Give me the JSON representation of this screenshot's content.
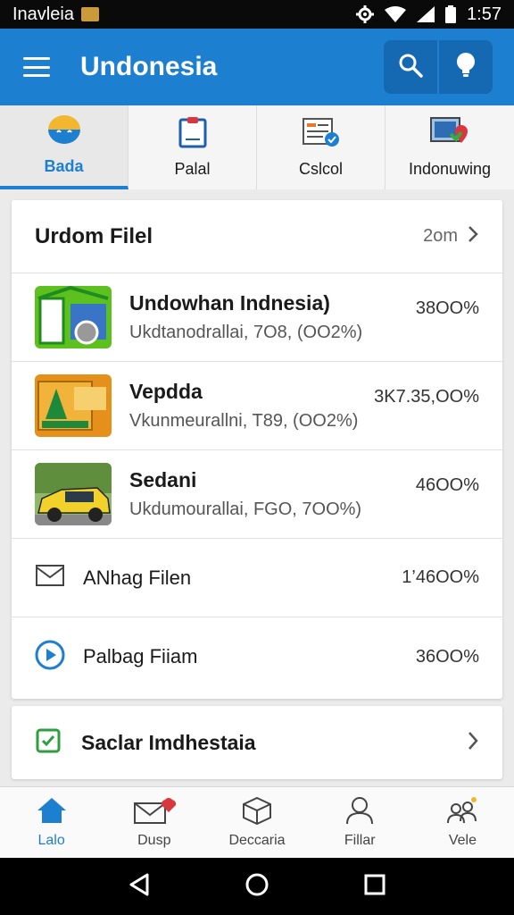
{
  "status_bar": {
    "carrier": "Inavleia",
    "time": "1:57",
    "icons": [
      "gear-icon",
      "wifi-icon",
      "signal-icon",
      "battery-icon"
    ]
  },
  "app_bar": {
    "title": "Undonesia",
    "menu_icon": "menu-icon",
    "actions": [
      "search-icon",
      "lightbulb-icon"
    ],
    "color": "#1d7fd0"
  },
  "tabs": [
    {
      "label": "Bada",
      "icon": "face-icon",
      "active": true
    },
    {
      "label": "Palal",
      "icon": "clipboard-icon",
      "active": false
    },
    {
      "label": "Cslcol",
      "icon": "checklist-icon",
      "active": false
    },
    {
      "label": "Indonuwing",
      "icon": "map-pin-icon",
      "active": false
    }
  ],
  "main_card": {
    "title": "Urdom Filel",
    "header_value": "2om",
    "rows": [
      {
        "title": "Undowhan Indnesia)",
        "subtitle": "Ukdtanodrallai, 7O8, (OO2%)",
        "value": "38OO%"
      },
      {
        "title": "Vepdda",
        "subtitle": "Vkunmeurallni, T89, (OO2%)",
        "value": "3K7.35,OO%"
      },
      {
        "title": "Sedani",
        "subtitle": "Ukdumourallai, FGO, 7OO%)",
        "value": "46OO%"
      },
      {
        "title": "ANhag Filen",
        "icon": "mail-icon",
        "value": "1’46OO%"
      },
      {
        "title": "Palbag Fiiam",
        "icon": "play-circle-icon",
        "value": "36OO%"
      }
    ]
  },
  "bottom_card": {
    "label": "Saclar Imdhestaia",
    "icon": "check-square-icon"
  },
  "bottom_nav": [
    {
      "label": "Lalo",
      "icon": "home-icon",
      "active": true
    },
    {
      "label": "Dusp",
      "icon": "envelope-heart-icon",
      "active": false
    },
    {
      "label": "Deccaria",
      "icon": "box-icon",
      "active": false
    },
    {
      "label": "Fillar",
      "icon": "person-icon",
      "active": false
    },
    {
      "label": "Vele",
      "icon": "people-icon",
      "active": false
    }
  ],
  "system_nav": [
    "back-icon",
    "home-circle-icon",
    "recents-icon"
  ]
}
